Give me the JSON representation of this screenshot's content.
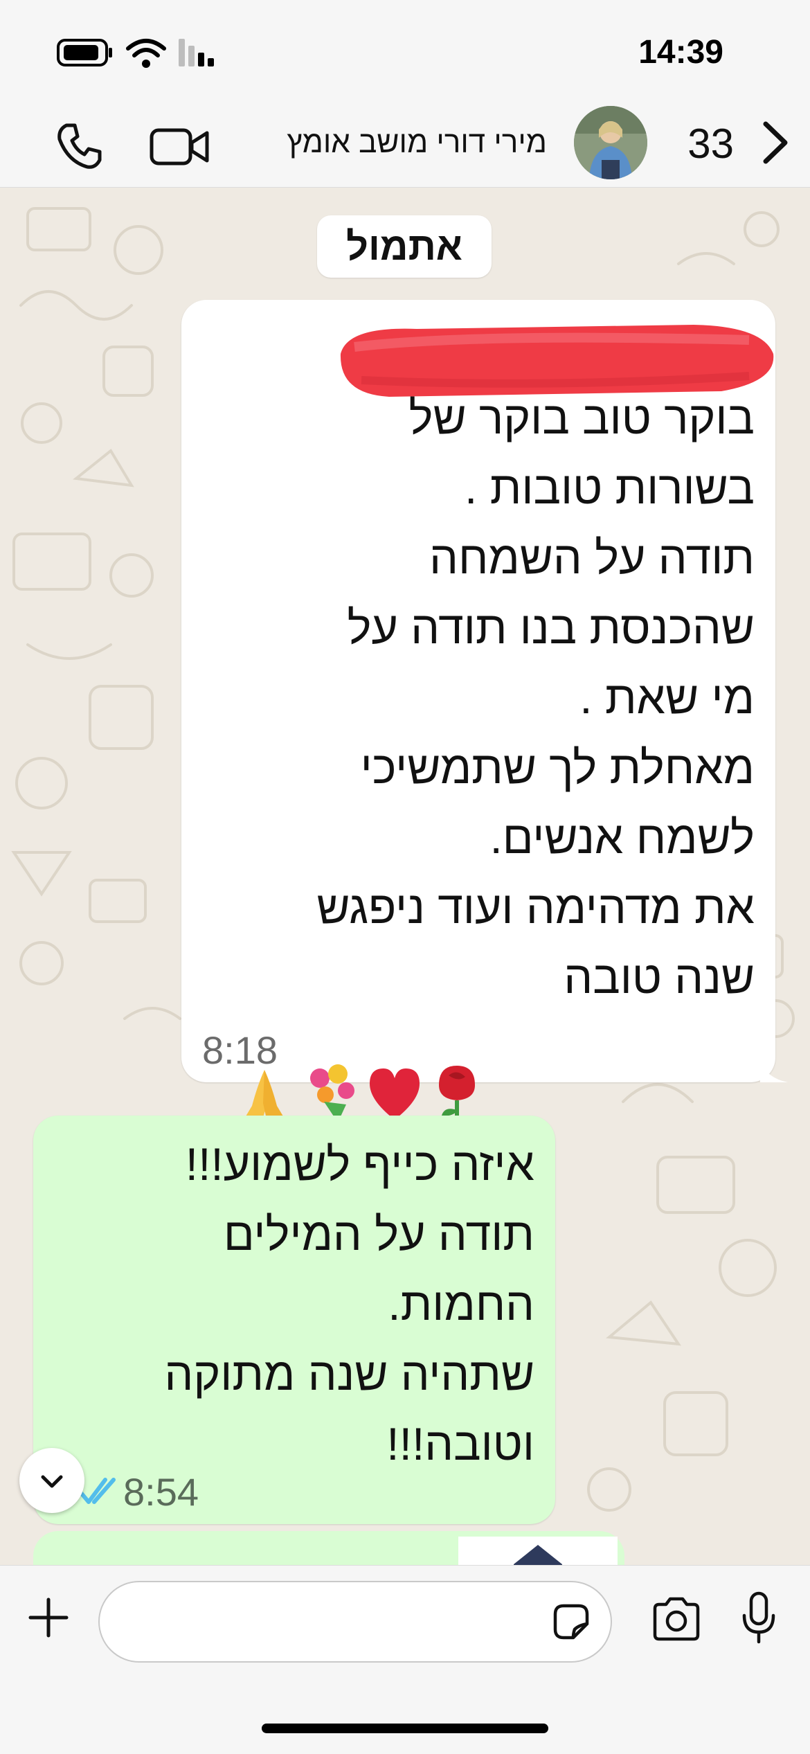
{
  "status_bar": {
    "time": "14:39",
    "icons": [
      "battery-icon",
      "wifi-icon",
      "signal-icon"
    ]
  },
  "header": {
    "contact_name": "מירי דורי מושב אומץ",
    "unread_count": "33",
    "icons": [
      "chevron-left-icon",
      "avatar",
      "video-icon",
      "phone-icon"
    ]
  },
  "chat": {
    "date_separator": "אתמול",
    "messages": [
      {
        "direction": "incoming",
        "lines": [
          "בוקר טוב בוקר של",
          "בשורות טובות .",
          "תודה על השמחה",
          "שהכנסת בנו תודה על",
          "מי שאת .",
          "מאחלת לך שתמשיכי",
          "לשמח אנשים.",
          "את מדהימה ועוד ניפגש",
          "שנה טובה"
        ],
        "emojis": [
          "rose-icon",
          "red-heart-icon",
          "bouquet-icon",
          "folded-hands-icon"
        ],
        "time": "8:18"
      },
      {
        "direction": "outgoing",
        "lines": [
          "איזה כייף לשמוע!!!",
          "תודה על המילים",
          "החמות.",
          "שתהיה שנה מתוקה",
          "וטובה!!!"
        ],
        "time": "8:54",
        "status": "read"
      }
    ]
  },
  "input_bar": {
    "placeholder": "",
    "icons": [
      "plus-icon",
      "sticker-icon",
      "camera-icon",
      "microphone-icon"
    ]
  },
  "colors": {
    "incoming_bubble": "#ffffff",
    "outgoing_bubble": "#d9fdd3",
    "chat_background": "#efeae2",
    "read_ticks": "#53bdeb",
    "bars": "#f6f6f6"
  }
}
